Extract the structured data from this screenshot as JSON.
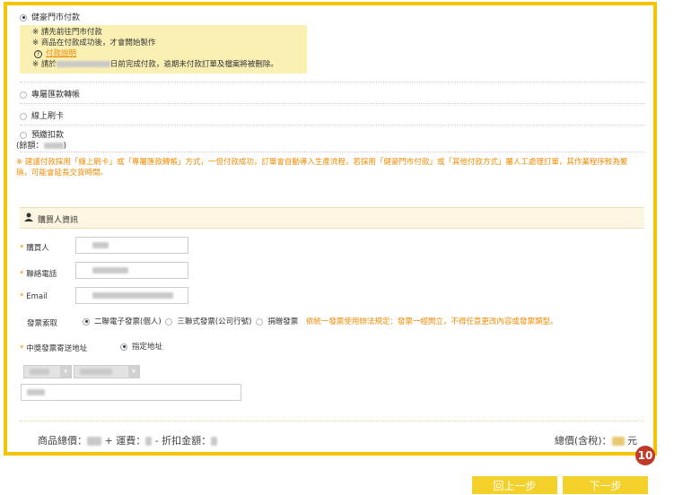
{
  "payment": {
    "options": [
      {
        "label": "健豪門市付款",
        "selected": true
      },
      {
        "label": "專屬匯款轉帳",
        "selected": false
      },
      {
        "label": "線上刷卡",
        "selected": false
      },
      {
        "label": "預繳扣款",
        "selected": false
      }
    ],
    "notes": {
      "line1": "※ 請先前往門市付款",
      "line2": "※ 商品在付款成功後，才會開始製作",
      "help_link": "付款說明",
      "line4_prefix": "※ 請於",
      "line4_suffix": "日前完成付款，逾期未付款訂單及檔案將被刪除。"
    },
    "balance_label": "(餘額：",
    "balance_suffix": ")",
    "warning": "※ 建議付款採用「線上刷卡」或「專屬匯款轉帳」方式，一但付款成功，訂單會自動導入生產流程，若採用「健豪門市付款」或「其他付款方式」屬人工處理訂單，其作業程序較為繁瑣，可能會延長交貨時間。",
    "warning_line1": "※ 建議付款採用「線上刷卡」或「專屬匯款轉帳」方式，一但付款成功，訂單會自動導入生產流程，若採用「健豪門市付款」或「其他付款方式」屬人工處理訂單，其作業程序較為繁",
    "warning_line2": "瑣，可能會延長交貨時間。"
  },
  "buyer": {
    "section_title": "購買人資訊",
    "fields": {
      "name_label": "購買人",
      "phone_label": "聯絡電話",
      "email_label": "Email",
      "invoice_label": "發票索取",
      "mail_label": "中獎發票寄送地址"
    },
    "invoice_options": [
      "二聯電子發票(個人)",
      "三聯式發票(公司行號)",
      "捐贈發票"
    ],
    "invoice_note": "依統一發票使用辦法規定：發票一經開立，不得任意更改內容或發票類型。",
    "address_option": "指定地址"
  },
  "totals": {
    "subtotal_label": "商品總價：",
    "shipping_label": "+ 運費：",
    "discount_label": "- 折扣金額：",
    "total_label": "總價(含稅)：",
    "currency": "元"
  },
  "step_badge": "10",
  "buttons": {
    "prev": "回上一步",
    "next": "下一步"
  },
  "colors": {
    "accent": "#f5c400",
    "warning": "#f08a00",
    "badge": "#c0392b"
  }
}
